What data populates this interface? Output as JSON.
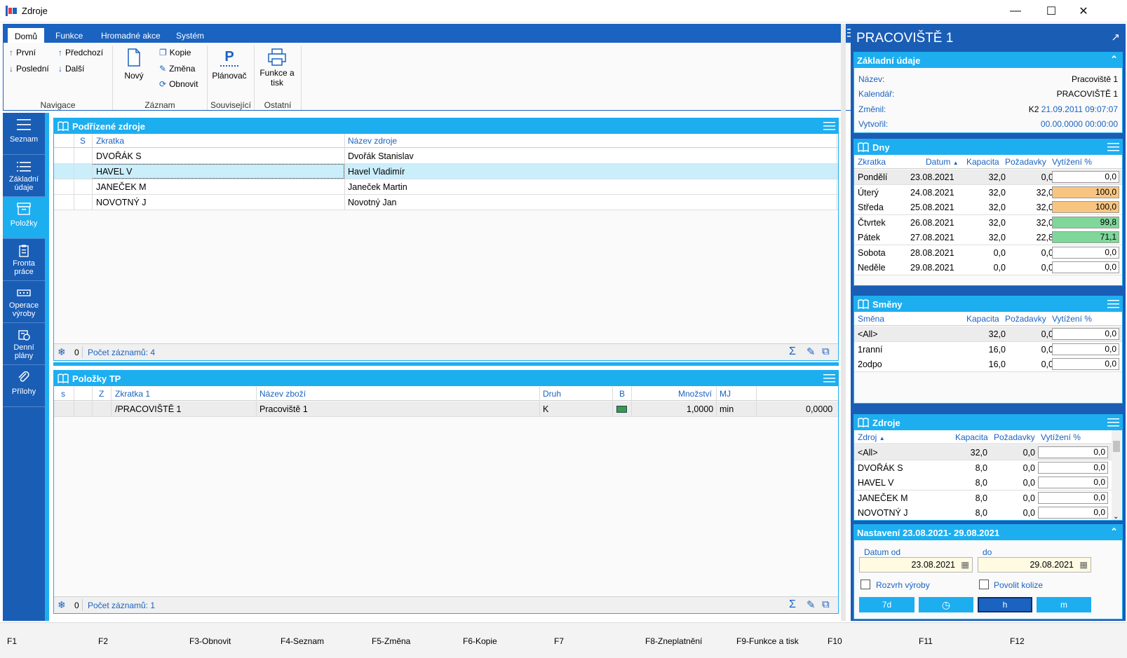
{
  "window": {
    "title": "Zdroje"
  },
  "ribbon": {
    "tabs": [
      "Domů",
      "Funkce",
      "Hromadné akce",
      "Systém"
    ],
    "nav": {
      "first": "První",
      "prev": "Předchozí",
      "last": "Poslední",
      "next": "Další",
      "group": "Navigace"
    },
    "record": {
      "new": "Nový",
      "copy": "Kopie",
      "change": "Změna",
      "refresh": "Obnovit",
      "group": "Záznam"
    },
    "related": {
      "planner": "Plánovač",
      "planner_icon_letter": "P",
      "group": "Související"
    },
    "other": {
      "print_line1": "Funkce a",
      "print_line2": "tisk",
      "group": "Ostatní"
    }
  },
  "leftnav": {
    "items": [
      {
        "l1": "Seznam",
        "l2": ""
      },
      {
        "l1": "Základní",
        "l2": "údaje"
      },
      {
        "l1": "Položky",
        "l2": ""
      },
      {
        "l1": "Fronta",
        "l2": "práce"
      },
      {
        "l1": "Operace",
        "l2": "výroby"
      },
      {
        "l1": "Denní",
        "l2": "plány"
      },
      {
        "l1": "Přílohy",
        "l2": ""
      }
    ]
  },
  "sub": {
    "title": "Podřízené zdroje",
    "headers": {
      "s": "S",
      "code": "Zkratka",
      "name": "Název zdroje"
    },
    "rows": [
      {
        "code": "DVOŘÁK S",
        "name": "Dvořák Stanislav"
      },
      {
        "code": "HAVEL V",
        "name": "Havel Vladimír"
      },
      {
        "code": "JANEČEK M",
        "name": "Janeček Martin"
      },
      {
        "code": "NOVOTNÝ J",
        "name": "Novotný Jan"
      }
    ],
    "footer": {
      "zero": "0",
      "count": "Počet záznamů: 4"
    }
  },
  "tp": {
    "title": "Položky TP",
    "headers": {
      "s": "s",
      "z": "Z",
      "code": "Zkratka 1",
      "name": "Název zboží",
      "kind": "Druh",
      "b": "B",
      "qty": "Množství",
      "unit": "MJ"
    },
    "rows": [
      {
        "code": "/PRACOVIŠTĚ 1",
        "name": "Pracoviště 1",
        "kind": "K",
        "qty": "1,0000",
        "unit": "min",
        "val": "0,0000"
      }
    ],
    "footer": {
      "zero": "0",
      "count": "Počet záznamů: 1"
    }
  },
  "right": {
    "title": "PRACOVIŠTĚ 1",
    "basic": {
      "title": "Základní údaje",
      "name_l": "Název:",
      "name_v": "Pracoviště 1",
      "cal_l": "Kalendář:",
      "cal_v": "PRACOVIŠTĚ 1",
      "changed_l": "Změnil:",
      "changed_user": "K2",
      "changed_date": "21.09.2011 09:07:07",
      "created_l": "Vytvořil:",
      "created_date": "00.00.0000 00:00:00"
    },
    "days": {
      "title": "Dny",
      "headers": {
        "code": "Zkratka",
        "date": "Datum",
        "cap": "Kapacita",
        "req": "Požadavky",
        "util": "Vytížení %"
      },
      "rows": [
        {
          "code": "Pondělí",
          "date": "23.08.2021",
          "cap": "32,0",
          "req": "0,0",
          "util": "0,0",
          "color": "#ffffff"
        },
        {
          "code": "Úterý",
          "date": "24.08.2021",
          "cap": "32,0",
          "req": "32,0",
          "util": "100,0",
          "color": "#f8c581"
        },
        {
          "code": "Středa",
          "date": "25.08.2021",
          "cap": "32,0",
          "req": "32,0",
          "util": "100,0",
          "color": "#f8c581"
        },
        {
          "code": "Čtvrtek",
          "date": "26.08.2021",
          "cap": "32,0",
          "req": "32,0",
          "util": "99,8",
          "color": "#7fd79a"
        },
        {
          "code": "Pátek",
          "date": "27.08.2021",
          "cap": "32,0",
          "req": "22,8",
          "util": "71,1",
          "color": "#7fd79a"
        },
        {
          "code": "Sobota",
          "date": "28.08.2021",
          "cap": "0,0",
          "req": "0,0",
          "util": "0,0",
          "color": "#ffffff"
        },
        {
          "code": "Neděle",
          "date": "29.08.2021",
          "cap": "0,0",
          "req": "0,0",
          "util": "0,0",
          "color": "#ffffff"
        }
      ]
    },
    "shifts": {
      "title": "Směny",
      "headers": {
        "shift": "Směna",
        "cap": "Kapacita",
        "req": "Požadavky",
        "util": "Vytížení %"
      },
      "rows": [
        {
          "shift": "<All>",
          "cap": "32,0",
          "req": "0,0",
          "util": "0,0"
        },
        {
          "shift": "1ranní",
          "cap": "16,0",
          "req": "0,0",
          "util": "0,0"
        },
        {
          "shift": "2odpo",
          "cap": "16,0",
          "req": "0,0",
          "util": "0,0"
        }
      ]
    },
    "resources": {
      "title": "Zdroje",
      "headers": {
        "res": "Zdroj",
        "cap": "Kapacita",
        "req": "Požadavky",
        "util": "Vytížení %"
      },
      "rows": [
        {
          "res": "<All>",
          "cap": "32,0",
          "req": "0,0",
          "util": "0,0"
        },
        {
          "res": "DVOŘÁK S",
          "cap": "8,0",
          "req": "0,0",
          "util": "0,0"
        },
        {
          "res": "HAVEL V",
          "cap": "8,0",
          "req": "0,0",
          "util": "0,0"
        },
        {
          "res": "JANEČEK M",
          "cap": "8,0",
          "req": "0,0",
          "util": "0,0"
        },
        {
          "res": "NOVOTNÝ J",
          "cap": "8,0",
          "req": "0,0",
          "util": "0,0"
        }
      ]
    },
    "settings": {
      "title": "Nastavení 23.08.2021- 29.08.2021",
      "from_l": "Datum od",
      "to_l": "do",
      "from_v": "23.08.2021",
      "to_v": "29.08.2021",
      "chk1": "Rozvrh výroby",
      "chk2": "Povolit kolize",
      "btn_7d": "7d",
      "btn_h": "h",
      "btn_m": "m"
    }
  },
  "fkeys": [
    "F1",
    "F2",
    "F3-Obnovit",
    "F4-Seznam",
    "F5-Změna",
    "F6-Kopie",
    "F7",
    "F8-Zneplatnění",
    "F9-Funkce a tisk",
    "F10",
    "F11",
    "F12"
  ]
}
